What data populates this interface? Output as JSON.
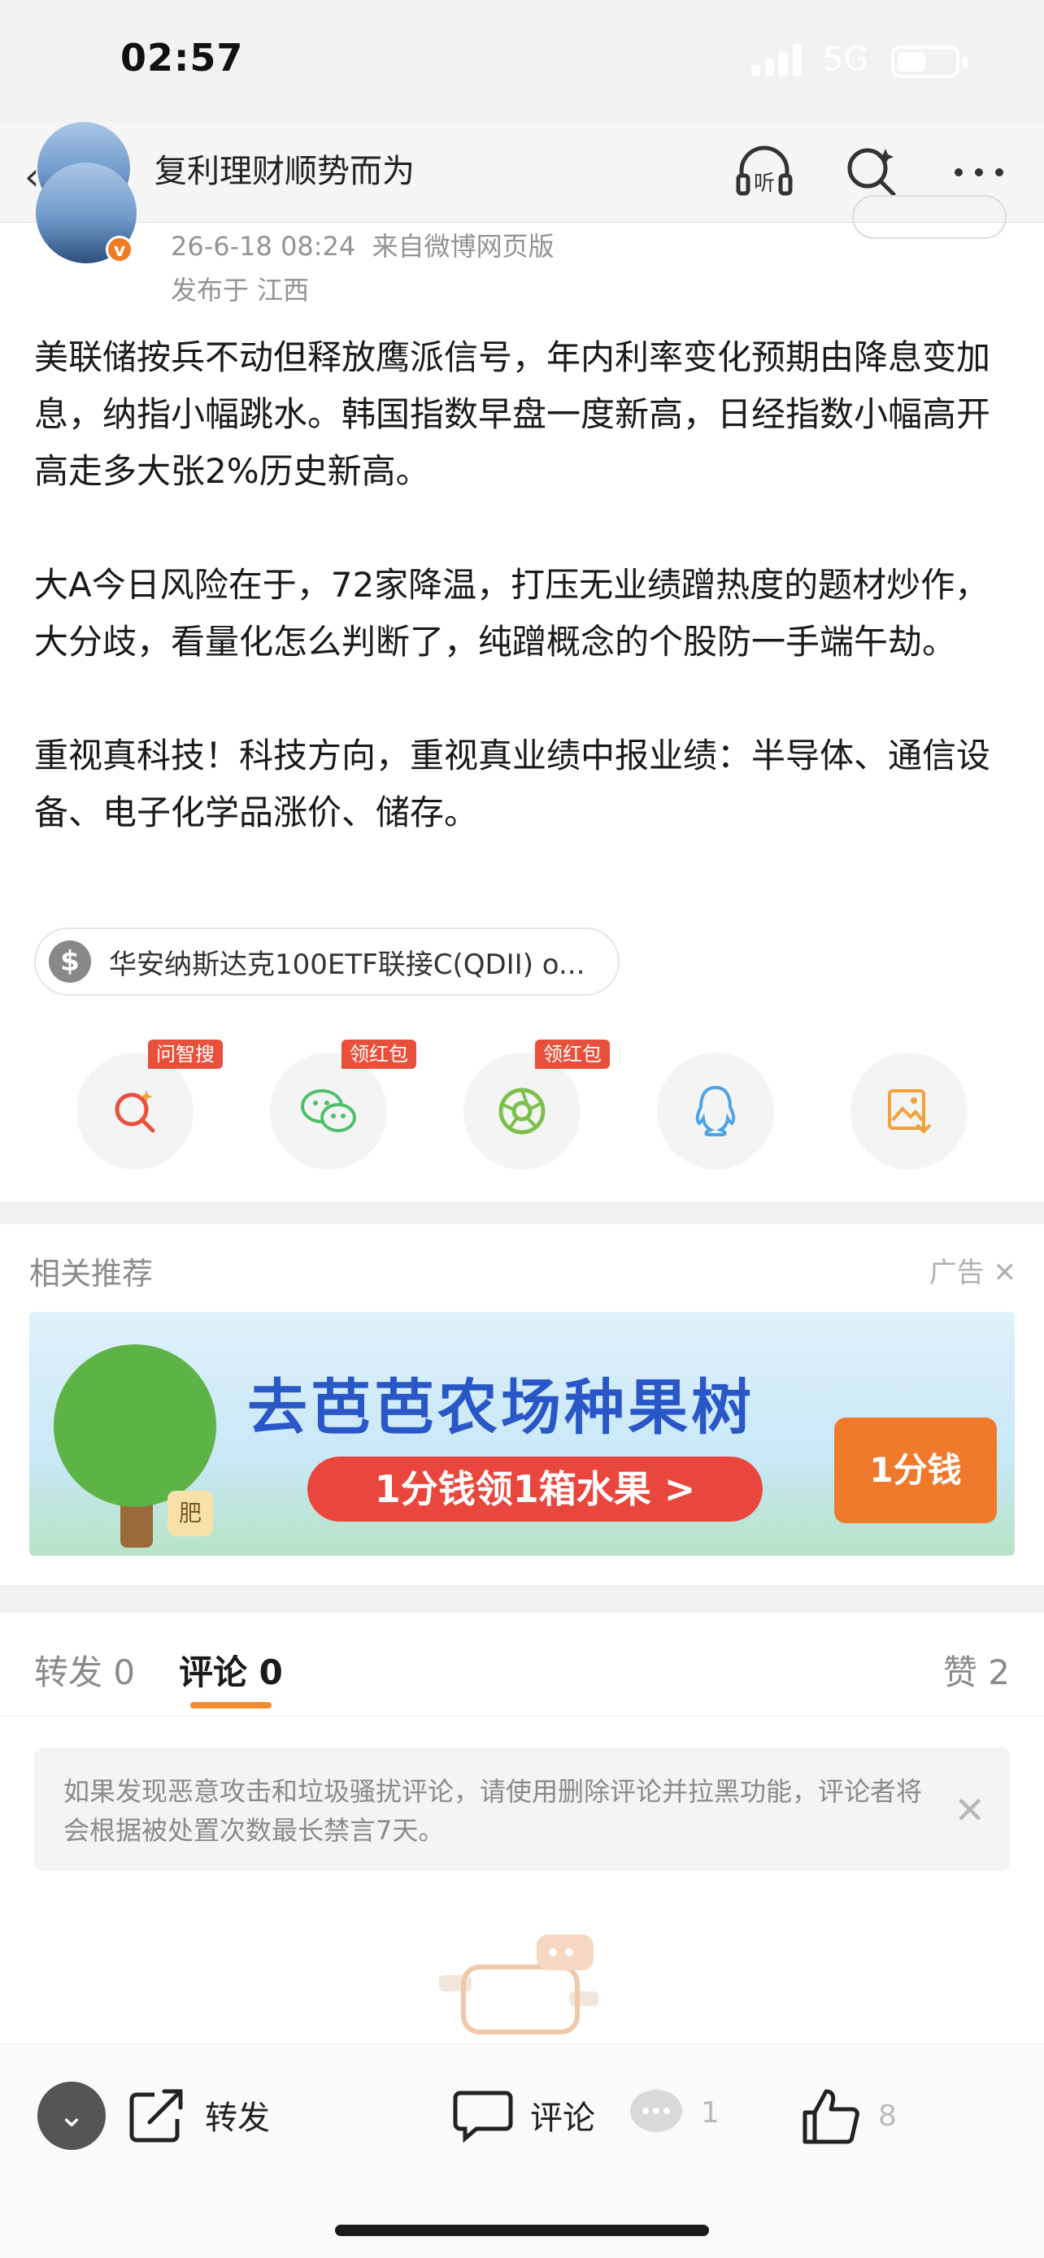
{
  "status_bar": {
    "time": "02:57",
    "network": "5G"
  },
  "header": {
    "title": "复利理财顺势而为",
    "listen_label": "听"
  },
  "post": {
    "timestamp": "26-6-18 08:24",
    "source": "来自微博网页版",
    "location": "发布于 江西",
    "paragraphs": [
      "美联储按兵不动但释放鹰派信号，年内利率变化预期由降息变加息，纳指小幅跳水。韩国指数早盘一度新高，日经指数小幅高开高走多大张2%历史新高。",
      "大A今日风险在于，72家降温，打压无业绩蹭热度的题材炒作，大分歧，看量化怎么判断了，纯蹭概念的个股防一手端午劫。",
      "重视真科技！科技方向，重视真业绩中报业绩：半导体、通信设备、电子化学品涨价、储存。"
    ],
    "fund_chip": {
      "icon": "$",
      "label": "华安纳斯达克100ETF联接C(QDII) o..."
    }
  },
  "share_row": {
    "items": [
      {
        "name": "问智搜",
        "tag": "问智搜",
        "icon": "search-sparkle-icon"
      },
      {
        "name": "wechat",
        "tag": "领红包",
        "icon": "wechat-icon"
      },
      {
        "name": "moments",
        "tag": "领红包",
        "icon": "moments-icon"
      },
      {
        "name": "qq",
        "tag": "",
        "icon": "qq-icon"
      },
      {
        "name": "save-image",
        "tag": "",
        "icon": "save-image-icon"
      }
    ]
  },
  "recommend": {
    "title": "相关推荐",
    "ad_label": "广告",
    "ad_headline": "去芭芭农场种果树",
    "ad_cta": "1分钱领1箱水果 >",
    "ad_basket": "1分钱",
    "ad_sign": "肥"
  },
  "tabs": {
    "repost": "转发 0",
    "comment": "评论 0",
    "like": "赞 2"
  },
  "notice": {
    "text": "如果发现恶意攻击和垃圾骚扰评论，请使用删除评论并拉黑功能，评论者将会根据被处置次数最长禁言7天。"
  },
  "bottom_bar": {
    "repost_label": "转发",
    "comment_label": "评论",
    "comment_count": "1",
    "like_count": "8"
  },
  "colors": {
    "accent_orange": "#f28b2d",
    "tag_red": "#e9503c",
    "ad_blue": "#2a57c7"
  }
}
